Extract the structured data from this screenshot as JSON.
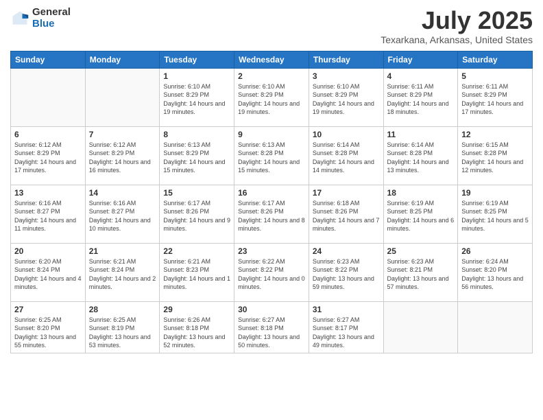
{
  "logo": {
    "general": "General",
    "blue": "Blue"
  },
  "header": {
    "title": "July 2025",
    "subtitle": "Texarkana, Arkansas, United States"
  },
  "weekdays": [
    "Sunday",
    "Monday",
    "Tuesday",
    "Wednesday",
    "Thursday",
    "Friday",
    "Saturday"
  ],
  "weeks": [
    [
      {
        "day": "",
        "info": ""
      },
      {
        "day": "",
        "info": ""
      },
      {
        "day": "1",
        "info": "Sunrise: 6:10 AM\nSunset: 8:29 PM\nDaylight: 14 hours and 19 minutes."
      },
      {
        "day": "2",
        "info": "Sunrise: 6:10 AM\nSunset: 8:29 PM\nDaylight: 14 hours and 19 minutes."
      },
      {
        "day": "3",
        "info": "Sunrise: 6:10 AM\nSunset: 8:29 PM\nDaylight: 14 hours and 19 minutes."
      },
      {
        "day": "4",
        "info": "Sunrise: 6:11 AM\nSunset: 8:29 PM\nDaylight: 14 hours and 18 minutes."
      },
      {
        "day": "5",
        "info": "Sunrise: 6:11 AM\nSunset: 8:29 PM\nDaylight: 14 hours and 17 minutes."
      }
    ],
    [
      {
        "day": "6",
        "info": "Sunrise: 6:12 AM\nSunset: 8:29 PM\nDaylight: 14 hours and 17 minutes."
      },
      {
        "day": "7",
        "info": "Sunrise: 6:12 AM\nSunset: 8:29 PM\nDaylight: 14 hours and 16 minutes."
      },
      {
        "day": "8",
        "info": "Sunrise: 6:13 AM\nSunset: 8:29 PM\nDaylight: 14 hours and 15 minutes."
      },
      {
        "day": "9",
        "info": "Sunrise: 6:13 AM\nSunset: 8:28 PM\nDaylight: 14 hours and 15 minutes."
      },
      {
        "day": "10",
        "info": "Sunrise: 6:14 AM\nSunset: 8:28 PM\nDaylight: 14 hours and 14 minutes."
      },
      {
        "day": "11",
        "info": "Sunrise: 6:14 AM\nSunset: 8:28 PM\nDaylight: 14 hours and 13 minutes."
      },
      {
        "day": "12",
        "info": "Sunrise: 6:15 AM\nSunset: 8:28 PM\nDaylight: 14 hours and 12 minutes."
      }
    ],
    [
      {
        "day": "13",
        "info": "Sunrise: 6:16 AM\nSunset: 8:27 PM\nDaylight: 14 hours and 11 minutes."
      },
      {
        "day": "14",
        "info": "Sunrise: 6:16 AM\nSunset: 8:27 PM\nDaylight: 14 hours and 10 minutes."
      },
      {
        "day": "15",
        "info": "Sunrise: 6:17 AM\nSunset: 8:26 PM\nDaylight: 14 hours and 9 minutes."
      },
      {
        "day": "16",
        "info": "Sunrise: 6:17 AM\nSunset: 8:26 PM\nDaylight: 14 hours and 8 minutes."
      },
      {
        "day": "17",
        "info": "Sunrise: 6:18 AM\nSunset: 8:26 PM\nDaylight: 14 hours and 7 minutes."
      },
      {
        "day": "18",
        "info": "Sunrise: 6:19 AM\nSunset: 8:25 PM\nDaylight: 14 hours and 6 minutes."
      },
      {
        "day": "19",
        "info": "Sunrise: 6:19 AM\nSunset: 8:25 PM\nDaylight: 14 hours and 5 minutes."
      }
    ],
    [
      {
        "day": "20",
        "info": "Sunrise: 6:20 AM\nSunset: 8:24 PM\nDaylight: 14 hours and 4 minutes."
      },
      {
        "day": "21",
        "info": "Sunrise: 6:21 AM\nSunset: 8:24 PM\nDaylight: 14 hours and 2 minutes."
      },
      {
        "day": "22",
        "info": "Sunrise: 6:21 AM\nSunset: 8:23 PM\nDaylight: 14 hours and 1 minutes."
      },
      {
        "day": "23",
        "info": "Sunrise: 6:22 AM\nSunset: 8:22 PM\nDaylight: 14 hours and 0 minutes."
      },
      {
        "day": "24",
        "info": "Sunrise: 6:23 AM\nSunset: 8:22 PM\nDaylight: 13 hours and 59 minutes."
      },
      {
        "day": "25",
        "info": "Sunrise: 6:23 AM\nSunset: 8:21 PM\nDaylight: 13 hours and 57 minutes."
      },
      {
        "day": "26",
        "info": "Sunrise: 6:24 AM\nSunset: 8:20 PM\nDaylight: 13 hours and 56 minutes."
      }
    ],
    [
      {
        "day": "27",
        "info": "Sunrise: 6:25 AM\nSunset: 8:20 PM\nDaylight: 13 hours and 55 minutes."
      },
      {
        "day": "28",
        "info": "Sunrise: 6:25 AM\nSunset: 8:19 PM\nDaylight: 13 hours and 53 minutes."
      },
      {
        "day": "29",
        "info": "Sunrise: 6:26 AM\nSunset: 8:18 PM\nDaylight: 13 hours and 52 minutes."
      },
      {
        "day": "30",
        "info": "Sunrise: 6:27 AM\nSunset: 8:18 PM\nDaylight: 13 hours and 50 minutes."
      },
      {
        "day": "31",
        "info": "Sunrise: 6:27 AM\nSunset: 8:17 PM\nDaylight: 13 hours and 49 minutes."
      },
      {
        "day": "",
        "info": ""
      },
      {
        "day": "",
        "info": ""
      }
    ]
  ]
}
